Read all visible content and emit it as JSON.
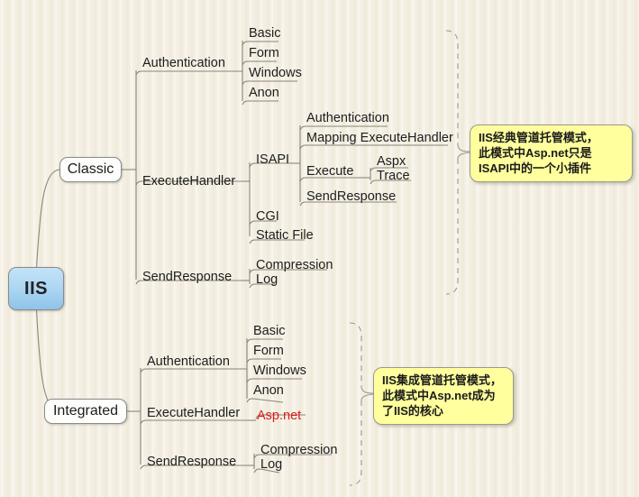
{
  "diagram": {
    "title": "IIS",
    "root": {
      "label": "IIS"
    },
    "branches": [
      {
        "label": "Classic"
      },
      {
        "label": "Integrated"
      }
    ],
    "classic": {
      "authentication": {
        "label": "Authentication",
        "children": [
          "Basic",
          "Form",
          "Windows",
          "Anon"
        ]
      },
      "execute_handler": {
        "label": "ExecuteHandler",
        "children": [
          {
            "label": "ISAPI",
            "children": [
              {
                "label": "Authentication"
              },
              {
                "label": "Mapping ExecuteHandler"
              },
              {
                "label": "Execute",
                "children": [
                  "Aspx",
                  "Trace"
                ]
              },
              {
                "label": "SendResponse"
              }
            ]
          },
          {
            "label": "CGI"
          },
          {
            "label": "Static File"
          }
        ]
      },
      "send_response": {
        "label": "SendResponse",
        "children": [
          "Compression",
          "Log"
        ]
      }
    },
    "integrated": {
      "authentication": {
        "label": "Authentication",
        "children": [
          "Basic",
          "Form",
          "Windows",
          "Anon"
        ]
      },
      "execute_handler": {
        "label": "ExecuteHandler",
        "children": [
          "Asp.net"
        ]
      },
      "send_response": {
        "label": "SendResponse",
        "children": [
          "Compression",
          "Log"
        ]
      }
    },
    "notes": [
      {
        "text": "IIS经典管道托管模式，\n此模式中Asp.net只是\nISAPI中的一个小插件"
      },
      {
        "text": "IIS集成管道托管模式，\n此模式中Asp.net成为\n了IIS的核心"
      }
    ],
    "colors": {
      "root_fill": "#afd8f4",
      "note_fill": "#ffff9d",
      "accent_red": "#e01b1b",
      "line": "#8a8578",
      "background": "#f3eee1"
    }
  }
}
